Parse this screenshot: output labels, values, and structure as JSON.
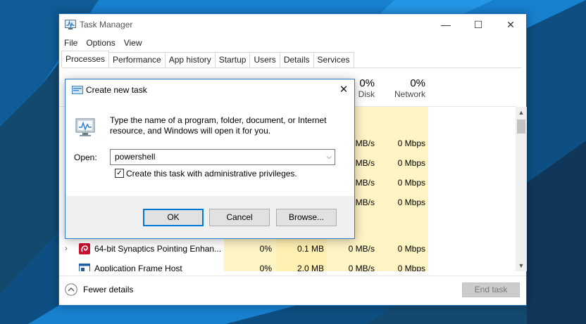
{
  "colors": {
    "desktop_blue": "#1780cf",
    "desktop_dark": "#0d4f82",
    "window_border": "#1b73c4",
    "heat_light": "#fff4c4",
    "heat_mid": "#fff0b3",
    "ok_accent": "#0078d7"
  },
  "task_manager": {
    "title": "Task Manager",
    "app_icon": "task-manager-icon",
    "controls": {
      "minimize": "—",
      "maximize": "☐",
      "close": "✕"
    },
    "menu": [
      "File",
      "Options",
      "View"
    ],
    "tabs": [
      "Processes",
      "Performance",
      "App history",
      "Startup",
      "Users",
      "Details",
      "Services"
    ],
    "active_tab": "Processes",
    "columns": {
      "disk": {
        "pct": "0%",
        "name": "Disk"
      },
      "network": {
        "pct": "0%",
        "name": "Network"
      }
    },
    "visible_values": {
      "disk_rows": [
        "MB/s",
        "MB/s",
        "MB/s",
        "MB/s"
      ],
      "network_rows": [
        "0 Mbps",
        "0 Mbps",
        "0 Mbps",
        "0 Mbps"
      ]
    },
    "processes": [
      {
        "name": "64-bit Synaptics Pointing Enhan...",
        "cpu": "0%",
        "memory": "0.1 MB",
        "disk": "0 MB/s",
        "network": "0 Mbps",
        "expand": "›",
        "icon": "synaptics-icon"
      },
      {
        "name": "Application Frame Host",
        "cpu": "0%",
        "memory": "2.0 MB",
        "disk": "0 MB/s",
        "network": "0 Mbps",
        "expand": "",
        "icon": "app-frame-icon"
      }
    ],
    "footer": {
      "fewer_details": "Fewer details",
      "end_task": "End task"
    }
  },
  "dialog": {
    "title": "Create new task",
    "close": "✕",
    "description": "Type the name of a program, folder, document, or Internet resource, and Windows will open it for you.",
    "open_label": "Open:",
    "open_value": "powershell",
    "admin_checked": true,
    "admin_label": "Create this task with administrative privileges.",
    "buttons": {
      "ok": "OK",
      "cancel": "Cancel",
      "browse": "Browse..."
    }
  }
}
